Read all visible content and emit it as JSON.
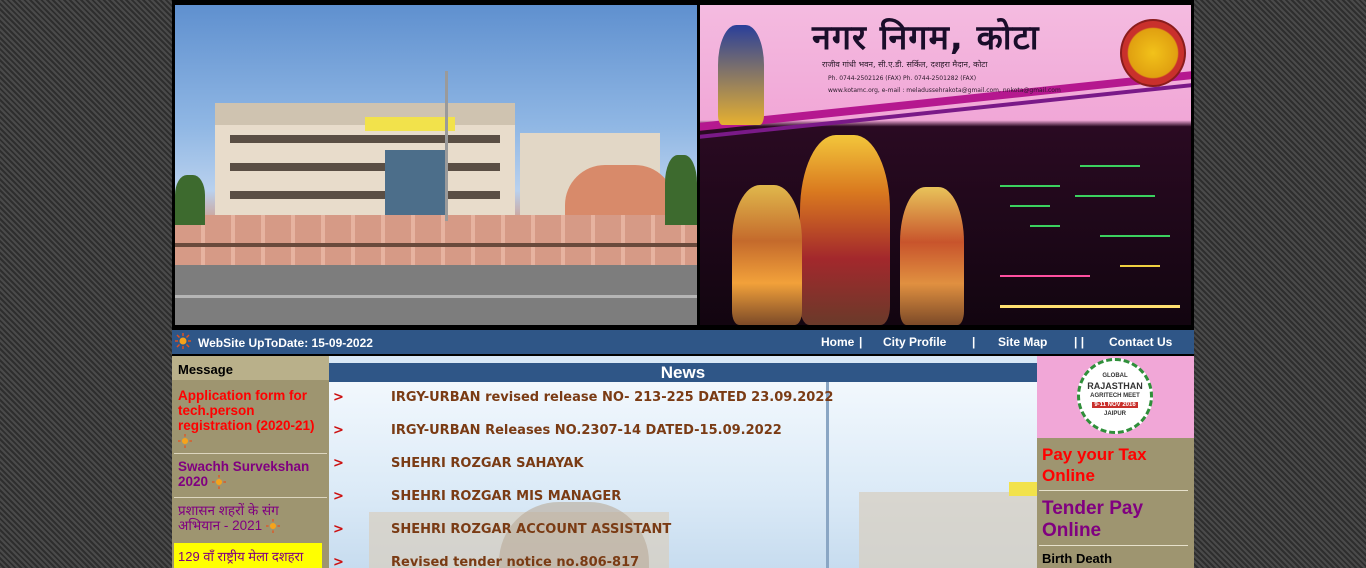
{
  "banner": {
    "title": "नगर निगम, कोटा",
    "address": "राजीव गांधी भवन, सी.ए.डी. सर्किल, दशहरा मैदान, कोटा",
    "phone": "Ph. 0744-2502126 (FAX) Ph. 0744-2501282 (FAX)",
    "web": "www.kotamc.org, e-mail : meladussehrakota@gmail.com, nnkota@gmail.com"
  },
  "navbar": {
    "update_label": "WebSite UpToDate: 15-09-2022",
    "links": [
      "Home",
      "City Profile",
      "Site Map",
      "Contact Us"
    ],
    "separators": [
      "|",
      "|",
      "| |"
    ]
  },
  "left": {
    "header": "Message",
    "items": [
      "Application form for tech.person registration (2020-21)",
      "Swachh Survekshan 2020",
      "प्रशासन शहरों के संग अभियान - 2021",
      "129 वाँ राष्ट्रीय मेला दशहरा"
    ]
  },
  "news": {
    "title": "News",
    "items": [
      "IRGY-URBAN revised release NO- 213-225 DATED 23.09.2022",
      "IRGY-URBAN Releases NO.2307-14 DATED-15.09.2022",
      "SHEHRI ROZGAR SAHAYAK",
      "SHEHRI ROZGAR MIS MANAGER",
      "SHEHRI ROZGAR ACCOUNT ASSISTANT",
      "Revised tender notice no.806-817"
    ],
    "arrow": ">"
  },
  "right": {
    "badge": {
      "line1": "GLOBAL",
      "line2": "RAJASTHAN",
      "line3": "AGRITECH MEET",
      "line4": "9-11 NOV 2016",
      "line5": "JAIPUR"
    },
    "links": [
      "Pay your Tax Online",
      "Tender Pay Online",
      "Birth Death"
    ]
  },
  "colors": {
    "nav_bg": "#2f5687",
    "sidebar_bg": "#9e9570",
    "news_text": "#7a3b14",
    "red_link": "#ff0000",
    "purple_link": "#800080"
  },
  "icons": {
    "sun": "sun-burst-icon"
  }
}
